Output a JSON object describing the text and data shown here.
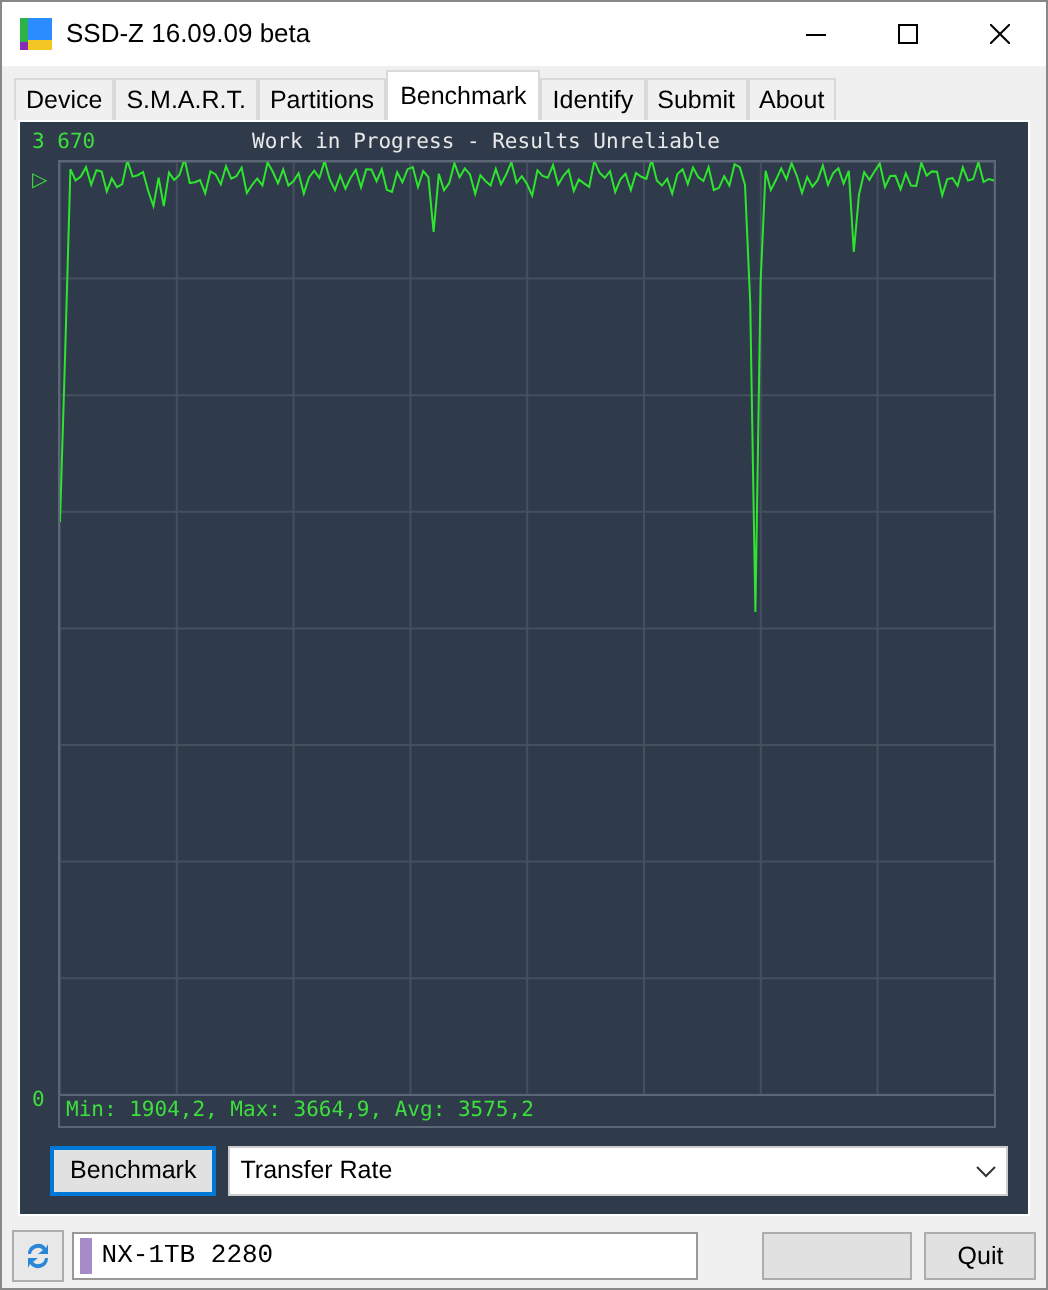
{
  "window": {
    "title": "SSD-Z 16.09.09 beta"
  },
  "tabs": [
    {
      "label": "Device",
      "selected": false
    },
    {
      "label": "S.M.A.R.T.",
      "selected": false
    },
    {
      "label": "Partitions",
      "selected": false
    },
    {
      "label": "Benchmark",
      "selected": true
    },
    {
      "label": "Identify",
      "selected": false
    },
    {
      "label": "Submit",
      "selected": false
    },
    {
      "label": "About",
      "selected": false
    }
  ],
  "chart": {
    "title": "Work in Progress - Results Unreliable",
    "y_max_label": "3 670",
    "y_min_label": "0",
    "marker": "▷",
    "stats": "Min: 1904,2, Max: 3664,9, Avg: 3575,2"
  },
  "benchmark_button": "Benchmark",
  "mode_select": {
    "value": "Transfer Rate"
  },
  "status_bar": {
    "drive": "NX-1TB 2280",
    "quit_button": "Quit"
  }
}
